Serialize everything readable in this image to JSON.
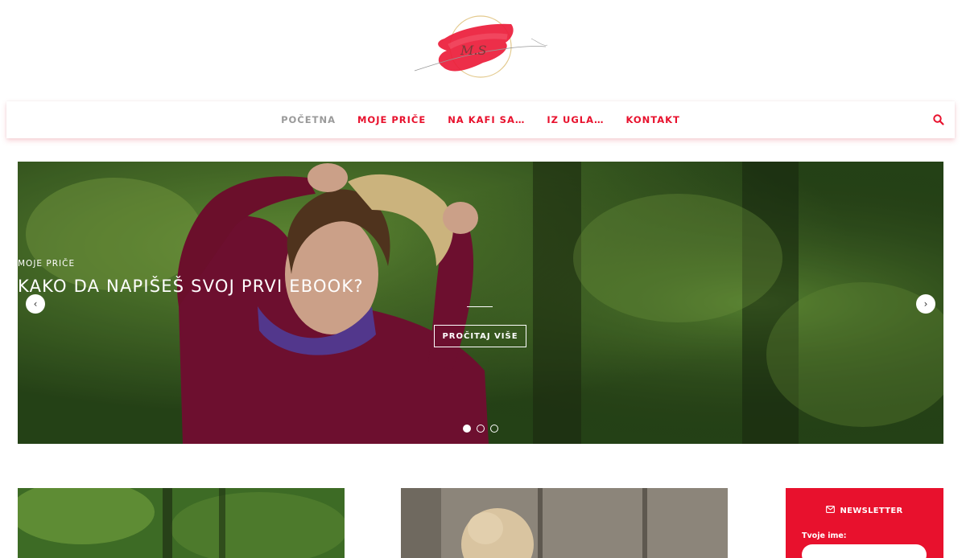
{
  "logo": {
    "text": "M.S"
  },
  "nav": {
    "items": [
      {
        "label": "POČETNA",
        "active": true
      },
      {
        "label": "MOJE PRIČE",
        "active": false
      },
      {
        "label": "NA KAFI SA…",
        "active": false
      },
      {
        "label": "IZ UGLA…",
        "active": false
      },
      {
        "label": "KONTAKT",
        "active": false
      }
    ],
    "search_icon": "search-icon"
  },
  "hero": {
    "category": "MOJE PRIČE",
    "title": "KAKO DA NAPIŠEŠ SVOJ PRVI EBOOK?",
    "button": "PROČITAJ VIŠE",
    "prev": "‹",
    "next": "›",
    "slides": 3,
    "active_slide": 1
  },
  "newsletter": {
    "title": "NEWSLETTER",
    "name_label": "Tvoje ime:",
    "name_value": ""
  },
  "colors": {
    "accent": "#e8112d",
    "nav_active": "#9a9a9a"
  }
}
